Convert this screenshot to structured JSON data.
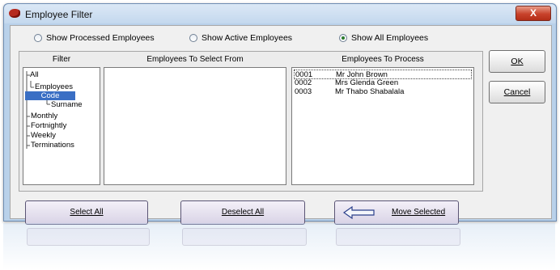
{
  "window": {
    "title": "Employee Filter",
    "close_label": "X"
  },
  "filter_options": [
    {
      "label": "Show Processed Employees",
      "checked": false
    },
    {
      "label": "Show Active Employees",
      "checked": false
    },
    {
      "label": "Show All Employees",
      "checked": true
    }
  ],
  "columns": {
    "filter": "Filter",
    "select_from": "Employees To Select From",
    "to_process": "Employees To Process"
  },
  "tree": [
    {
      "label": "All"
    },
    {
      "label": "Employees"
    },
    {
      "label": "Code",
      "selected": true
    },
    {
      "label": "Surname"
    },
    {
      "label": "Monthly"
    },
    {
      "label": "Fortnightly"
    },
    {
      "label": "Weekly"
    },
    {
      "label": "Terminations"
    }
  ],
  "employees_to_process": [
    {
      "code": "0001",
      "name": "Mr John Brown"
    },
    {
      "code": "0002",
      "name": "Mrs Glenda Green"
    },
    {
      "code": "0003",
      "name": "Mr Thabo Shabalala"
    }
  ],
  "buttons": {
    "ok": "OK",
    "cancel": "Cancel",
    "select_all": "Select All",
    "deselect_all": "Deselect All",
    "move_selected": "Move Selected"
  }
}
